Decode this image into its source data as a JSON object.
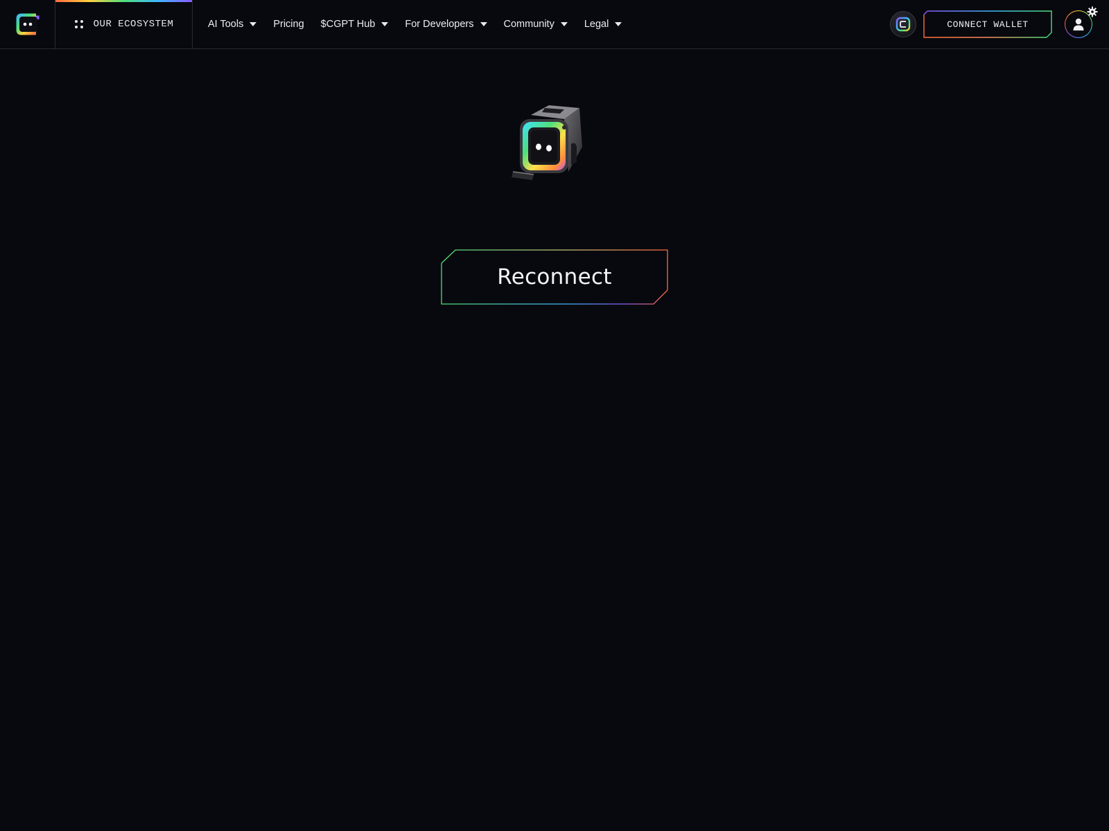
{
  "navbar": {
    "logo_icon": "chaingpt-logo-icon",
    "ecosystem_label": "OUR ECOSYSTEM",
    "ecosystem_icon": "grid-dots-icon",
    "menu": [
      {
        "label": "AI Tools",
        "has_dropdown": true
      },
      {
        "label": "Pricing",
        "has_dropdown": false
      },
      {
        "label": "$CGPT Hub",
        "has_dropdown": true
      },
      {
        "label": "For Developers",
        "has_dropdown": true
      },
      {
        "label": "Community",
        "has_dropdown": true
      },
      {
        "label": "Legal",
        "has_dropdown": true
      }
    ],
    "token_icon": "cgpt-token-icon",
    "connect_wallet_label": "CONNECT WALLET",
    "avatar_icon": "user-icon",
    "settings_icon": "gear-icon"
  },
  "main": {
    "mascot_icon": "robot-cube-mascot",
    "reconnect_label": "Reconnect"
  },
  "colors": {
    "background": "#08090e",
    "border": "#2a2b33",
    "gradient": [
      "#ff6a3d",
      "#ffd23f",
      "#4ee07a",
      "#3fb7ff",
      "#8a5cff"
    ]
  }
}
